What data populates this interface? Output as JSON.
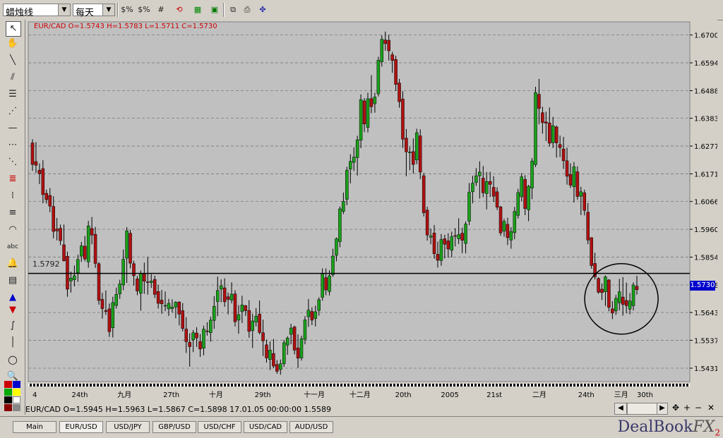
{
  "toolbar": {
    "chart_type": "蜡烛线",
    "timeframe": "每天",
    "buttons": [
      "$%",
      "$%",
      "#",
      "zoom",
      "grid",
      "save",
      "print",
      "settings"
    ]
  },
  "colors": {
    "up": "#1aa01a",
    "down": "#b01010",
    "bg": "#c0c0c0",
    "grid": "#7a7a7a",
    "accent": "#0000cc"
  },
  "chart": {
    "title": "EUR/CAD O=1.5743 H=1.5783 L=1.5711 C=1.5730",
    "hline_label": "1.5792",
    "last_price": "1.5730",
    "y_ticks": [
      "1.6700",
      "1.6594",
      "1.6488",
      "1.6383",
      "1.6277",
      "1.6171",
      "1.6066",
      "1.5960",
      "1.5854",
      "1.5748",
      "1.5643",
      "1.5537",
      "1.5431"
    ],
    "x_ticks": [
      "4",
      "24th",
      "九月",
      "27th",
      "十月",
      "29th",
      "十一月",
      "十二月",
      "20th",
      "2005",
      "21st",
      "二月",
      "24th",
      "三月",
      "30th"
    ]
  },
  "chart_data": {
    "type": "candlestick",
    "symbol": "EUR/CAD",
    "ylim": [
      1.538,
      1.675
    ],
    "hline": 1.5792,
    "candles": [
      [
        1.6289,
        1.6303,
        1.6183,
        1.6207
      ],
      [
        1.6218,
        1.6292,
        1.6175,
        1.6204
      ],
      [
        1.6185,
        1.6211,
        1.6132,
        1.6172
      ],
      [
        1.6191,
        1.6223,
        1.6059,
        1.6092
      ],
      [
        1.6097,
        1.6111,
        1.6058,
        1.6073
      ],
      [
        1.6089,
        1.6117,
        1.6025,
        1.6048
      ],
      [
        1.6047,
        1.6086,
        1.5926,
        1.5952
      ],
      [
        1.5961,
        1.6003,
        1.5918,
        1.5954
      ],
      [
        1.5964,
        1.5978,
        1.59,
        1.5917
      ],
      [
        1.5901,
        1.5978,
        1.5837,
        1.584
      ],
      [
        1.5857,
        1.5875,
        1.5703,
        1.5732
      ],
      [
        1.5763,
        1.5799,
        1.5719,
        1.5774
      ],
      [
        1.5768,
        1.5822,
        1.5743,
        1.5783
      ],
      [
        1.5794,
        1.5863,
        1.576,
        1.5845
      ],
      [
        1.5858,
        1.5912,
        1.5836,
        1.5897
      ],
      [
        1.5896,
        1.5935,
        1.5838,
        1.5847
      ],
      [
        1.5836,
        1.5992,
        1.5814,
        1.5973
      ],
      [
        1.5963,
        1.6007,
        1.5903,
        1.5938
      ],
      [
        1.5941,
        1.5969,
        1.5813,
        1.583
      ],
      [
        1.5829,
        1.5835,
        1.5673,
        1.5689
      ],
      [
        1.5693,
        1.5718,
        1.562,
        1.5658
      ],
      [
        1.5651,
        1.5727,
        1.5634,
        1.5647
      ],
      [
        1.5657,
        1.5677,
        1.555,
        1.557
      ],
      [
        1.5585,
        1.5703,
        1.5548,
        1.5681
      ],
      [
        1.567,
        1.5738,
        1.5658,
        1.5712
      ],
      [
        1.5714,
        1.5768,
        1.5695,
        1.5752
      ],
      [
        1.5748,
        1.5883,
        1.5728,
        1.5846
      ],
      [
        1.585,
        1.5968,
        1.5756,
        1.5954
      ],
      [
        1.5945,
        1.5958,
        1.5811,
        1.5831
      ],
      [
        1.5829,
        1.584,
        1.5746,
        1.5783
      ],
      [
        1.5771,
        1.5782,
        1.5709,
        1.5725
      ],
      [
        1.5716,
        1.5803,
        1.565,
        1.5792
      ],
      [
        1.579,
        1.5833,
        1.5714,
        1.5762
      ],
      [
        1.576,
        1.5855,
        1.5711,
        1.5758
      ],
      [
        1.5757,
        1.5789,
        1.5737,
        1.5763
      ],
      [
        1.5769,
        1.5783,
        1.5698,
        1.5712
      ],
      [
        1.5723,
        1.5748,
        1.5658,
        1.5678
      ],
      [
        1.569,
        1.5729,
        1.5638,
        1.5676
      ],
      [
        1.5669,
        1.5723,
        1.5648,
        1.567
      ],
      [
        1.5657,
        1.5695,
        1.563,
        1.5678
      ],
      [
        1.5658,
        1.5693,
        1.5643,
        1.5664
      ],
      [
        1.5664,
        1.5686,
        1.5621,
        1.5682
      ],
      [
        1.5683,
        1.5686,
        1.5594,
        1.5637
      ],
      [
        1.565,
        1.5679,
        1.5571,
        1.5582
      ],
      [
        1.558,
        1.5625,
        1.5489,
        1.5532
      ],
      [
        1.553,
        1.5564,
        1.5437,
        1.5513
      ],
      [
        1.5539,
        1.5576,
        1.5492,
        1.5566
      ],
      [
        1.5565,
        1.5587,
        1.5512,
        1.5546
      ],
      [
        1.5532,
        1.5561,
        1.5474,
        1.5504
      ],
      [
        1.5507,
        1.5593,
        1.548,
        1.558
      ],
      [
        1.5573,
        1.5606,
        1.5555,
        1.5571
      ],
      [
        1.5566,
        1.5627,
        1.5532,
        1.5614
      ],
      [
        1.5613,
        1.5705,
        1.5581,
        1.5667
      ],
      [
        1.5685,
        1.578,
        1.5629,
        1.5727
      ],
      [
        1.5732,
        1.5769,
        1.5682,
        1.5745
      ],
      [
        1.5737,
        1.5773,
        1.5665,
        1.5684
      ],
      [
        1.5703,
        1.5719,
        1.5636,
        1.5693
      ],
      [
        1.569,
        1.5758,
        1.5678,
        1.5713
      ],
      [
        1.5714,
        1.5728,
        1.559,
        1.5608
      ],
      [
        1.5614,
        1.5671,
        1.5562,
        1.5635
      ],
      [
        1.5647,
        1.5707,
        1.5603,
        1.5672
      ],
      [
        1.5669,
        1.5672,
        1.563,
        1.565
      ],
      [
        1.5651,
        1.569,
        1.5547,
        1.5571
      ],
      [
        1.5574,
        1.5638,
        1.5508,
        1.5611
      ],
      [
        1.5607,
        1.566,
        1.559,
        1.5629
      ],
      [
        1.5637,
        1.5689,
        1.556,
        1.5567
      ],
      [
        1.5566,
        1.5616,
        1.5477,
        1.5535
      ],
      [
        1.552,
        1.554,
        1.5452,
        1.547
      ],
      [
        1.5464,
        1.5533,
        1.5424,
        1.55
      ],
      [
        1.5487,
        1.5542,
        1.5431,
        1.5439
      ],
      [
        1.5445,
        1.5462,
        1.541,
        1.5419
      ],
      [
        1.5426,
        1.5464,
        1.5406,
        1.5448
      ],
      [
        1.5448,
        1.5539,
        1.5436,
        1.5528
      ],
      [
        1.5519,
        1.5552,
        1.5482,
        1.5546
      ],
      [
        1.556,
        1.56,
        1.5522,
        1.5584
      ],
      [
        1.5588,
        1.5593,
        1.5484,
        1.55
      ],
      [
        1.5508,
        1.556,
        1.5432,
        1.5469
      ],
      [
        1.547,
        1.5555,
        1.546,
        1.5543
      ],
      [
        1.5541,
        1.5629,
        1.5522,
        1.5615
      ],
      [
        1.5627,
        1.5694,
        1.5588,
        1.5652
      ],
      [
        1.5647,
        1.5663,
        1.5595,
        1.5614
      ],
      [
        1.562,
        1.5669,
        1.559,
        1.5646
      ],
      [
        1.5651,
        1.5701,
        1.5631,
        1.5692
      ],
      [
        1.5701,
        1.5811,
        1.5688,
        1.579
      ],
      [
        1.5776,
        1.5811,
        1.5709,
        1.5729
      ],
      [
        1.5723,
        1.5804,
        1.5708,
        1.5783
      ],
      [
        1.5787,
        1.5886,
        1.5779,
        1.5858
      ],
      [
        1.5861,
        1.5929,
        1.5838,
        1.5924
      ],
      [
        1.5913,
        1.6047,
        1.5892,
        1.6038
      ],
      [
        1.6028,
        1.61,
        1.6018,
        1.6066
      ],
      [
        1.6074,
        1.6198,
        1.6052,
        1.6185
      ],
      [
        1.6189,
        1.6246,
        1.6135,
        1.6219
      ],
      [
        1.6215,
        1.6272,
        1.6182,
        1.6235
      ],
      [
        1.6233,
        1.6316,
        1.6165,
        1.6301
      ],
      [
        1.6299,
        1.6474,
        1.6269,
        1.6454
      ],
      [
        1.6449,
        1.646,
        1.633,
        1.6361
      ],
      [
        1.6348,
        1.648,
        1.6329,
        1.6457
      ],
      [
        1.6458,
        1.6547,
        1.6402,
        1.6427
      ],
      [
        1.6438,
        1.648,
        1.6404,
        1.6464
      ],
      [
        1.6476,
        1.6617,
        1.6466,
        1.6604
      ],
      [
        1.6598,
        1.6699,
        1.658,
        1.6684
      ],
      [
        1.6681,
        1.6713,
        1.664,
        1.6667
      ],
      [
        1.668,
        1.6701,
        1.6603,
        1.664
      ],
      [
        1.6625,
        1.6636,
        1.6556,
        1.6603
      ],
      [
        1.6607,
        1.6621,
        1.6487,
        1.6512
      ],
      [
        1.6517,
        1.6533,
        1.6423,
        1.6446
      ],
      [
        1.6456,
        1.6486,
        1.627,
        1.6303
      ],
      [
        1.6307,
        1.6342,
        1.6162,
        1.6255
      ],
      [
        1.6254,
        1.6274,
        1.6185,
        1.6254
      ],
      [
        1.6256,
        1.6306,
        1.6172,
        1.6207
      ],
      [
        1.6224,
        1.6343,
        1.6208,
        1.6328
      ],
      [
        1.6316,
        1.6341,
        1.6151,
        1.6178
      ],
      [
        1.6164,
        1.6175,
        1.6009,
        1.6023
      ],
      [
        1.6033,
        1.6046,
        1.5917,
        1.5938
      ],
      [
        1.593,
        1.5963,
        1.5903,
        1.5935
      ],
      [
        1.5946,
        1.5976,
        1.5848,
        1.5867
      ],
      [
        1.5865,
        1.5913,
        1.5814,
        1.5842
      ],
      [
        1.5841,
        1.5942,
        1.5821,
        1.5921
      ],
      [
        1.5924,
        1.5939,
        1.5849,
        1.5903
      ],
      [
        1.5916,
        1.5945,
        1.5852,
        1.5885
      ],
      [
        1.588,
        1.5951,
        1.5853,
        1.5932
      ],
      [
        1.5936,
        1.5964,
        1.5895,
        1.5934
      ],
      [
        1.5924,
        1.6002,
        1.5904,
        1.594
      ],
      [
        1.5945,
        1.5966,
        1.5869,
        1.5918
      ],
      [
        1.5906,
        1.599,
        1.5869,
        1.598
      ],
      [
        1.5991,
        1.6136,
        1.5976,
        1.6101
      ],
      [
        1.6103,
        1.6164,
        1.6059,
        1.6136
      ],
      [
        1.6138,
        1.6193,
        1.6125,
        1.6164
      ],
      [
        1.6164,
        1.6219,
        1.6077,
        1.6178
      ],
      [
        1.6155,
        1.6201,
        1.6082,
        1.6099
      ],
      [
        1.6096,
        1.6178,
        1.6036,
        1.6142
      ],
      [
        1.6142,
        1.6179,
        1.6083,
        1.6131
      ],
      [
        1.612,
        1.6162,
        1.6064,
        1.6086
      ],
      [
        1.6103,
        1.612,
        1.6033,
        1.6044
      ],
      [
        1.6045,
        1.6049,
        1.5935,
        1.5946
      ],
      [
        1.5953,
        1.6,
        1.5932,
        1.599
      ],
      [
        1.5979,
        1.6004,
        1.59,
        1.5928
      ],
      [
        1.5919,
        1.5968,
        1.5886,
        1.5952
      ],
      [
        1.5947,
        1.6045,
        1.5922,
        1.6028
      ],
      [
        1.6013,
        1.6114,
        1.6001,
        1.61
      ],
      [
        1.6084,
        1.6174,
        1.6066,
        1.616
      ],
      [
        1.615,
        1.6166,
        1.6014,
        1.6039
      ],
      [
        1.6034,
        1.6129,
        1.5991,
        1.6124
      ],
      [
        1.6117,
        1.6231,
        1.6075,
        1.622
      ],
      [
        1.6206,
        1.6503,
        1.6197,
        1.6481
      ],
      [
        1.6474,
        1.6533,
        1.636,
        1.642
      ],
      [
        1.6404,
        1.6427,
        1.6324,
        1.6366
      ],
      [
        1.6369,
        1.6408,
        1.6296,
        1.6364
      ],
      [
        1.6365,
        1.6424,
        1.6275,
        1.6288
      ],
      [
        1.629,
        1.6388,
        1.627,
        1.6354
      ],
      [
        1.635,
        1.6355,
        1.6233,
        1.6289
      ],
      [
        1.6283,
        1.6317,
        1.6235,
        1.6271
      ],
      [
        1.6266,
        1.6312,
        1.619,
        1.6221
      ],
      [
        1.6221,
        1.6271,
        1.613,
        1.6162
      ],
      [
        1.6169,
        1.6211,
        1.6117,
        1.6128
      ],
      [
        1.6122,
        1.6216,
        1.6062,
        1.6198
      ],
      [
        1.6179,
        1.62,
        1.6073,
        1.6085
      ],
      [
        1.6086,
        1.6122,
        1.6014,
        1.6103
      ],
      [
        1.6099,
        1.6111,
        1.6013,
        1.6032
      ],
      [
        1.6025,
        1.606,
        1.5903,
        1.5919
      ],
      [
        1.5928,
        1.593,
        1.581,
        1.5822
      ],
      [
        1.583,
        1.5871,
        1.5769,
        1.5779
      ],
      [
        1.5773,
        1.5777,
        1.5715,
        1.572
      ],
      [
        1.5732,
        1.5754,
        1.5691,
        1.5719
      ],
      [
        1.5722,
        1.5784,
        1.5668,
        1.5779
      ],
      [
        1.5767,
        1.577,
        1.5648,
        1.5663
      ],
      [
        1.5657,
        1.5686,
        1.5618,
        1.5641
      ],
      [
        1.5649,
        1.571,
        1.5634,
        1.5697
      ],
      [
        1.568,
        1.5771,
        1.5651,
        1.5722
      ],
      [
        1.5702,
        1.5778,
        1.5631,
        1.5674
      ],
      [
        1.5689,
        1.5757,
        1.564,
        1.5669
      ],
      [
        1.5656,
        1.5717,
        1.5636,
        1.5687
      ],
      [
        1.5669,
        1.5758,
        1.5651,
        1.5748
      ],
      [
        1.5743,
        1.5783,
        1.5711,
        1.573
      ]
    ]
  },
  "info_line": "EUR/CAD O=1.5945 H=1.5963 L=1.5867 C=1.5898   17.01.05 00:00:00 1.5589",
  "scroll_controls": [
    "<",
    ">",
    "✥",
    "+",
    "−",
    "✕"
  ],
  "tabs": [
    {
      "label": "Main"
    },
    {
      "label": "EUR/USD"
    },
    {
      "label": "USD/JPY"
    },
    {
      "label": "GBP/USD"
    },
    {
      "label": "USD/CHF"
    },
    {
      "label": "USD/CAD"
    },
    {
      "label": "AUD/USD"
    }
  ],
  "brand": {
    "name": "DealBook",
    "fx": "FX",
    "version": "2"
  }
}
